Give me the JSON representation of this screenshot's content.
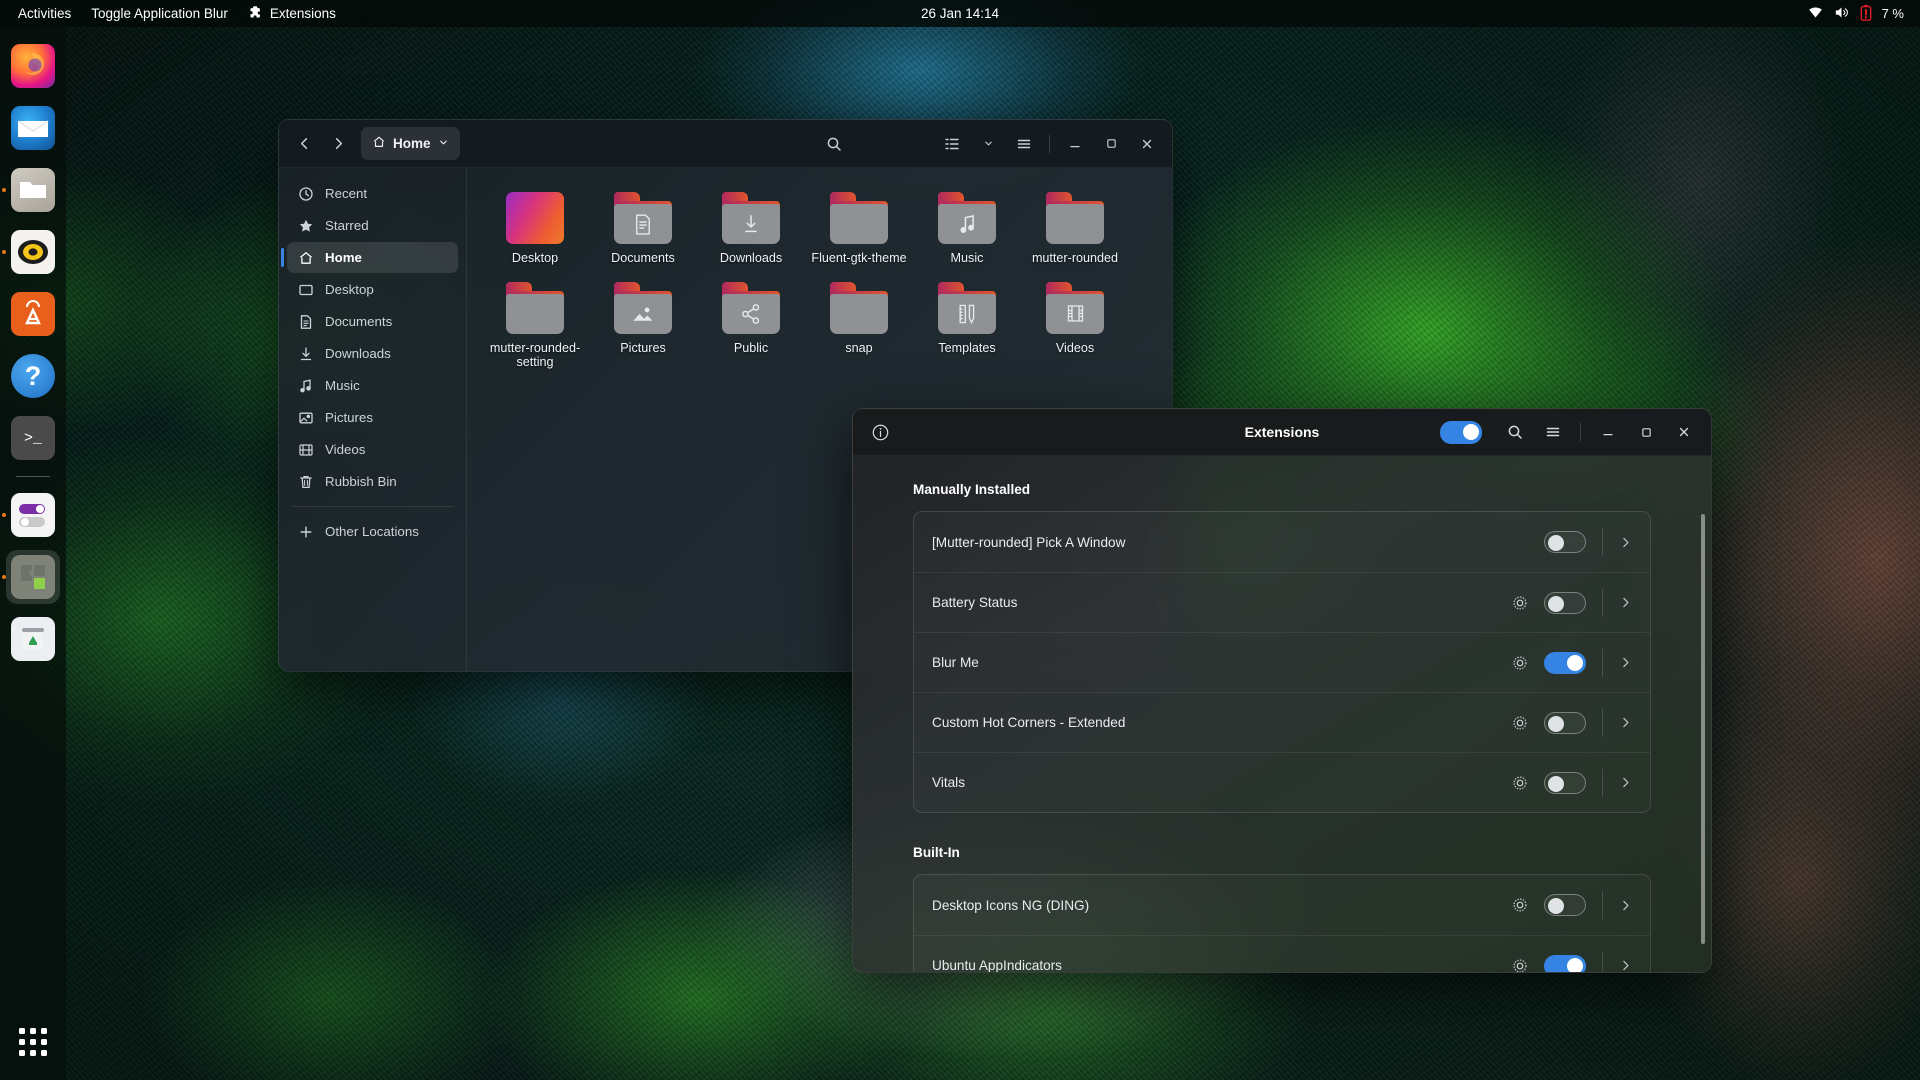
{
  "topbar": {
    "activities": "Activities",
    "app_menu": "Toggle Application Blur",
    "extensions_indicator": "Extensions",
    "clock": "26 Jan  14:14",
    "battery_percent": "7 %",
    "battery_color": "#e01b24"
  },
  "dock": {
    "items": [
      {
        "name": "firefox",
        "label": "Firefox",
        "running": false
      },
      {
        "name": "thunderbird",
        "label": "Thunderbird",
        "running": false
      },
      {
        "name": "files",
        "label": "Files",
        "running": true
      },
      {
        "name": "rhythmbox",
        "label": "Rhythmbox",
        "running": true
      },
      {
        "name": "ubuntu-software",
        "label": "Ubuntu Software",
        "running": false
      },
      {
        "name": "help",
        "label": "Help",
        "running": false
      },
      {
        "name": "terminal",
        "label": "Terminal",
        "running": false
      },
      {
        "name": "settings",
        "label": "Settings",
        "running": true
      },
      {
        "name": "extensions",
        "label": "Extensions",
        "running": true,
        "active": true
      },
      {
        "name": "rubbish-bin",
        "label": "Rubbish Bin",
        "running": false
      }
    ],
    "app_grid_label": "Show Applications"
  },
  "nautilus": {
    "title": "Home",
    "path_button": "Home",
    "sidebar": [
      {
        "label": "Recent",
        "icon": "clock-icon",
        "selected": false
      },
      {
        "label": "Starred",
        "icon": "star-icon",
        "selected": false
      },
      {
        "label": "Home",
        "icon": "home-icon",
        "selected": true
      },
      {
        "label": "Desktop",
        "icon": "desktop-icon",
        "selected": false
      },
      {
        "label": "Documents",
        "icon": "document-icon",
        "selected": false
      },
      {
        "label": "Downloads",
        "icon": "download-icon",
        "selected": false
      },
      {
        "label": "Music",
        "icon": "music-icon",
        "selected": false
      },
      {
        "label": "Pictures",
        "icon": "picture-icon",
        "selected": false
      },
      {
        "label": "Videos",
        "icon": "video-icon",
        "selected": false
      },
      {
        "label": "Rubbish Bin",
        "icon": "trash-icon",
        "selected": false
      }
    ],
    "sidebar_other": {
      "label": "Other Locations",
      "icon": "plus-icon"
    },
    "files": [
      {
        "label": "Desktop",
        "emblem": "none",
        "special": "gradient"
      },
      {
        "label": "Documents",
        "emblem": "document-icon"
      },
      {
        "label": "Downloads",
        "emblem": "download-icon"
      },
      {
        "label": "Fluent-gtk-theme",
        "emblem": "none"
      },
      {
        "label": "Music",
        "emblem": "music-icon"
      },
      {
        "label": "mutter-rounded",
        "emblem": "none"
      },
      {
        "label": "mutter-rounded-setting",
        "emblem": "none"
      },
      {
        "label": "Pictures",
        "emblem": "picture-icon"
      },
      {
        "label": "Public",
        "emblem": "share-icon"
      },
      {
        "label": "snap",
        "emblem": "none"
      },
      {
        "label": "Templates",
        "emblem": "template-icon"
      },
      {
        "label": "Videos",
        "emblem": "film-icon"
      }
    ]
  },
  "extensions_window": {
    "title": "Extensions",
    "info_icon": "info-icon",
    "master_toggle": true,
    "search_icon": "search-icon",
    "menu_icon": "hamburger-menu-icon",
    "sections": [
      {
        "title": "Manually Installed",
        "rows": [
          {
            "name": "[Mutter-rounded] Pick A Window",
            "enabled": false,
            "has_settings": false
          },
          {
            "name": "Battery Status",
            "enabled": false,
            "has_settings": true
          },
          {
            "name": "Blur Me",
            "enabled": true,
            "has_settings": true
          },
          {
            "name": "Custom Hot Corners - Extended",
            "enabled": false,
            "has_settings": true
          },
          {
            "name": "Vitals",
            "enabled": false,
            "has_settings": true
          }
        ]
      },
      {
        "title": "Built-In",
        "rows": [
          {
            "name": "Desktop Icons NG (DING)",
            "enabled": false,
            "has_settings": true
          },
          {
            "name": "Ubuntu AppIndicators",
            "enabled": true,
            "has_settings": true
          }
        ]
      }
    ],
    "accent_color": "#3584e4"
  }
}
